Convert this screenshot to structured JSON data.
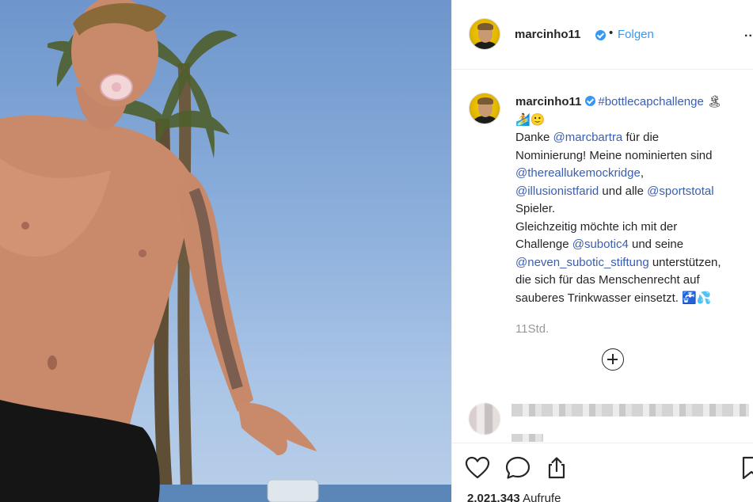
{
  "post": {
    "username": "marcinho11",
    "dot": "•",
    "follow_label": "Folgen",
    "more_label": "...",
    "caption": {
      "username": "marcinho11",
      "hashtag": "#bottlecapchallenge",
      "emoji_1": "🏝",
      "line2": "🏄🙂",
      "line3_a": "Danke ",
      "mention_marcbartra": "@marcbartra",
      "line3_b": " für die",
      "line4": "Nominierung! Meine nominierten sind",
      "mention_thereallukemockridge": "@thereallukemockridge",
      "line5_b": ",",
      "mention_illusionistfarid": "@illusionistfarid",
      "line6_b": " und alle ",
      "mention_sportstotal": "@sportstotal",
      "line7": "Spieler.",
      "line8": "Gleichzeitig möchte ich mit der",
      "line9_a": "Challenge ",
      "mention_subotic4": "@subotic4",
      "line9_b": " und seine",
      "mention_neven_subotic_stiftung": "@neven_subotic_stiftung",
      "line10_b": " unterstützen,",
      "line11": "die sich für das Menschenrecht auf",
      "line12": "sauberes Trinkwasser einsetzt. 🚰💦"
    },
    "timestamp": "11Std.",
    "views_count": "2.021.343",
    "views_label": "Aufrufe"
  },
  "icons": {
    "like": "heart-icon",
    "comment": "comment-icon",
    "share": "share-icon",
    "save": "bookmark-icon",
    "more_comments": "plus-circle-icon",
    "verified": "verified-badge-icon"
  },
  "colors": {
    "link": "#3b5eae",
    "follow": "#3897f0",
    "verified": "#3897f0",
    "muted": "#999999",
    "text": "#262626",
    "avatar_bg": "#f5d000"
  }
}
